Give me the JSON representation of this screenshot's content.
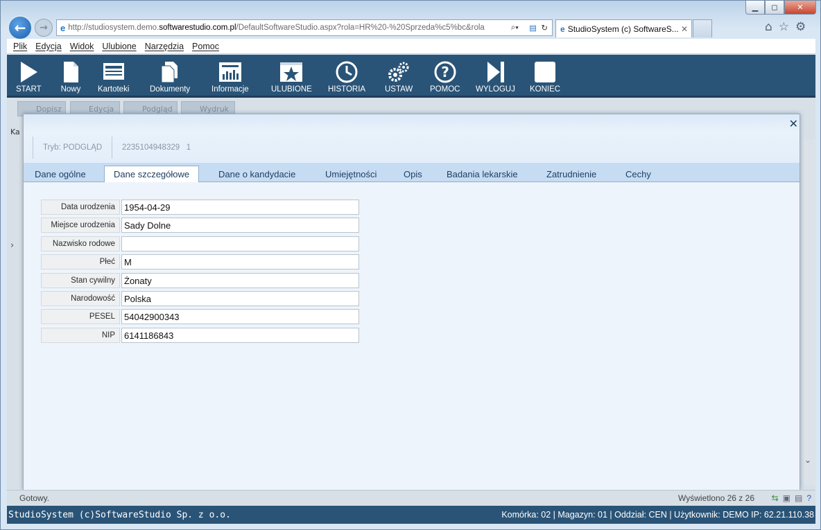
{
  "browser": {
    "url_prefix": "http://studiosystem.demo.",
    "url_domain": "softwarestudio.com.pl",
    "url_suffix": "/DefaultSoftwareStudio.aspx?rola=HR%20-%20Sprzeda%c5%bc&rola",
    "tab_title": "StudioSystem (c) SoftwareS...",
    "menu": [
      "Plik",
      "Edycja",
      "Widok",
      "Ulubione",
      "Narzędzia",
      "Pomoc"
    ]
  },
  "toolbar": {
    "items": [
      {
        "label": "START",
        "icon": "play-icon"
      },
      {
        "label": "Nowy",
        "icon": "new-document-icon"
      },
      {
        "label": "Kartoteki",
        "icon": "cards-icon"
      },
      {
        "label": "Dokumenty",
        "icon": "documents-icon"
      },
      {
        "label": "Informacje",
        "icon": "chart-icon"
      },
      {
        "label": "ULUBIONE",
        "icon": "star-icon"
      },
      {
        "label": "HISTORIA",
        "icon": "history-icon"
      },
      {
        "label": "USTAW",
        "icon": "gears-icon"
      },
      {
        "label": "POMOC",
        "icon": "help-icon"
      },
      {
        "label": "WYLOGUJ",
        "icon": "logout-icon"
      },
      {
        "label": "KONIEC",
        "icon": "stop-icon"
      }
    ]
  },
  "background": {
    "buttons": [
      "Dopisz",
      "Edycja",
      "Podgląd",
      "Wydruk"
    ],
    "left_label": "Ka"
  },
  "modal": {
    "mode": "Tryb: PODGLĄD",
    "record_id": "2235104948329   1",
    "tabs": [
      "Dane ogólne",
      "Dane szczegółowe",
      "Dane o kandydacie",
      "Umiejętności",
      "Opis",
      "Badania lekarskie",
      "Zatrudnienie",
      "Cechy"
    ],
    "active_tab": "Dane szczegółowe",
    "fields": [
      {
        "label": "Data urodzenia",
        "value": "1954-04-29"
      },
      {
        "label": "Miejsce urodzenia",
        "value": "Sady Dolne"
      },
      {
        "label": "Nazwisko rodowe",
        "value": ""
      },
      {
        "label": "Płeć",
        "value": "M"
      },
      {
        "label": "Stan cywilny",
        "value": "Żonaty"
      },
      {
        "label": "Narodowość",
        "value": "Polska"
      },
      {
        "label": "PESEL",
        "value": "54042900343"
      },
      {
        "label": "NIP",
        "value": "6141186843"
      }
    ]
  },
  "status": {
    "left": "Gotowy.",
    "right": "Wyświetlono 26 z 26"
  },
  "footer": {
    "left": "StudioSystem (c)SoftwareStudio Sp. z o.o.",
    "right": "Komórka: 02 | Magazyn: 01 | Oddział: CEN | Użytkownik: DEMO IP: 62.21.110.38"
  },
  "colors": {
    "app_bar": "#2a5477",
    "tab_strip": "#c6dcf3",
    "modal_body": "#eef4fb"
  }
}
